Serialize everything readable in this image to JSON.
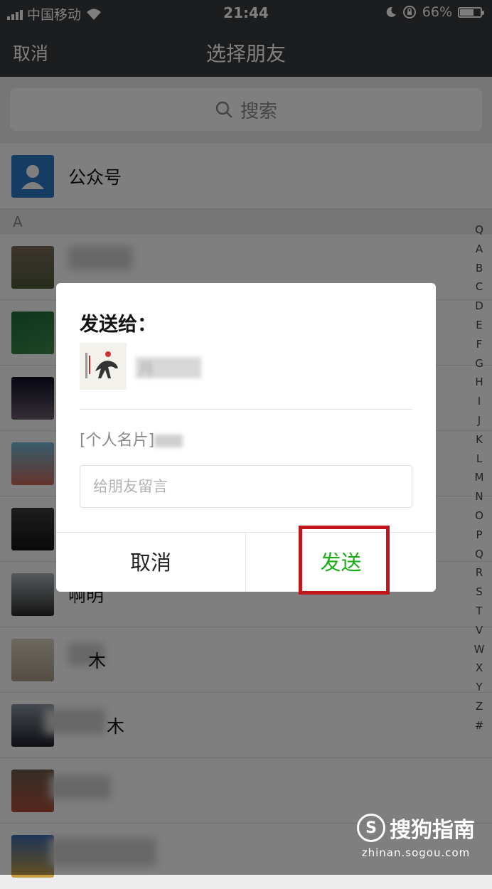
{
  "status_bar": {
    "carrier": "中国移动",
    "time": "21:44",
    "battery": "66%"
  },
  "nav": {
    "cancel": "取消",
    "title": "选择朋友"
  },
  "search": {
    "placeholder": "搜索"
  },
  "official": {
    "label": "公众号"
  },
  "section": {
    "letter": "A"
  },
  "contacts": [
    {
      "name": ""
    },
    {
      "name": ""
    },
    {
      "name": ""
    },
    {
      "name": ""
    },
    {
      "name": ""
    },
    {
      "name": "啊明"
    },
    {
      "name": "木"
    },
    {
      "name": "木"
    },
    {
      "name": ""
    },
    {
      "name": ""
    }
  ],
  "index": [
    "Q",
    "A",
    "B",
    "C",
    "D",
    "E",
    "F",
    "G",
    "H",
    "I",
    "J",
    "K",
    "L",
    "M",
    "N",
    "O",
    "P",
    "Q",
    "R",
    "S",
    "T",
    "V",
    "W",
    "X",
    "Y",
    "Z",
    "#"
  ],
  "dialog": {
    "send_to": "发送给：",
    "target_name": "月",
    "card_text": "[个人名片]",
    "message_placeholder": "给朋友留言",
    "cancel": "取消",
    "send": "发送"
  },
  "watermark": {
    "brand": "搜狗指南",
    "logo": "S",
    "url": "zhinan.sogou.com"
  }
}
